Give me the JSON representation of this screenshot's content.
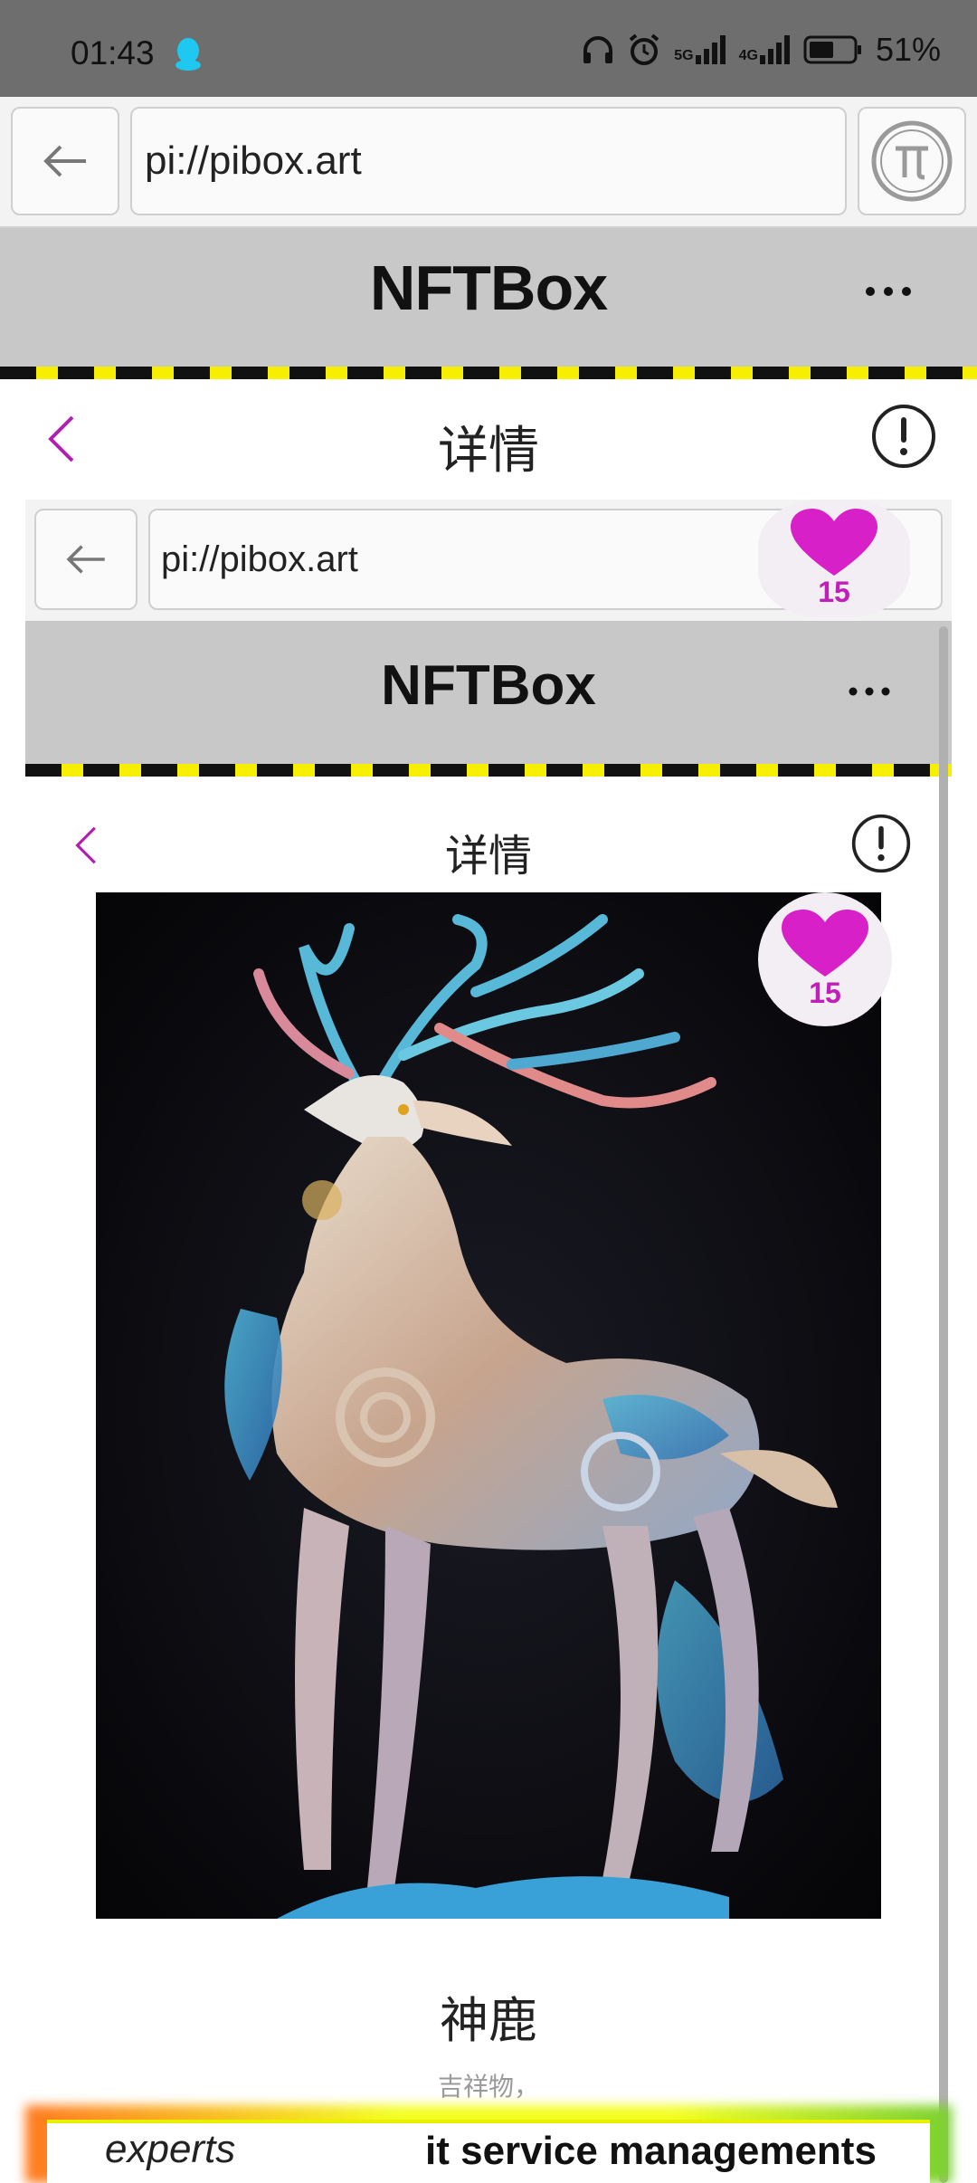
{
  "status_bar": {
    "time": "01:43",
    "battery": "51%",
    "network_1": "5G",
    "network_2": "4G"
  },
  "browser": {
    "url": "pi://pibox.art"
  },
  "app": {
    "title": "NFTBox"
  },
  "detail": {
    "title": "详情"
  },
  "nested": {
    "url": "pi://pibox.art",
    "app_title": "NFTBox",
    "detail_title": "详情",
    "like_count": "15"
  },
  "like": {
    "count": "15",
    "color": "#d020c8"
  },
  "nft": {
    "name": "神鹿",
    "description": "吉祥物，"
  },
  "ad": {
    "left_text": "experts",
    "right_text": "it service managements"
  },
  "icons": [
    "qq-icon",
    "headphones-icon",
    "alarm-icon",
    "signal-icon",
    "battery-icon",
    "back-arrow-icon",
    "pi-coin-icon",
    "more-icon",
    "chevron-left-icon",
    "info-icon",
    "heart-icon"
  ]
}
